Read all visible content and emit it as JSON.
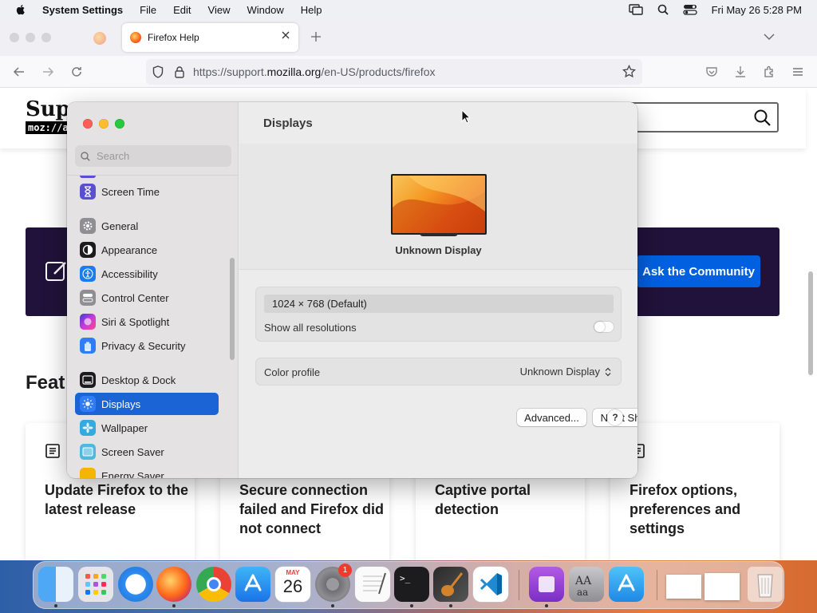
{
  "menubar": {
    "app_name": "System Settings",
    "items": [
      "File",
      "Edit",
      "View",
      "Window",
      "Help"
    ],
    "clock": "Fri May 26  5:28 PM"
  },
  "browser": {
    "tab_title": "Firefox Help",
    "url_prefix": "https://support.",
    "url_host": "mozilla.org",
    "url_path": "/en-US/products/firefox"
  },
  "page": {
    "logo_top": "Supp",
    "logo_badge": "moz://a",
    "banner_button": "Ask the Community",
    "featured_heading": "Feat",
    "cards": [
      "Update Firefox to the latest release",
      "Secure connection failed and Firefox did not connect",
      "Captive portal detection",
      "Firefox options, preferences and settings"
    ]
  },
  "settings": {
    "search_placeholder": "Search",
    "sidebar": [
      {
        "label": "Screen Time",
        "icon": "hourglass-icon",
        "color": "#5b4fd1"
      },
      {
        "label": "General",
        "icon": "gear-icon",
        "color": "#8e8e93"
      },
      {
        "label": "Appearance",
        "icon": "appearance-icon",
        "color": "#1c1c1e"
      },
      {
        "label": "Accessibility",
        "icon": "accessibility-icon",
        "color": "#1a7cf0"
      },
      {
        "label": "Control Center",
        "icon": "control-center-icon",
        "color": "#8e8e93"
      },
      {
        "label": "Siri & Spotlight",
        "icon": "siri-icon",
        "color": "#b43ad6"
      },
      {
        "label": "Privacy & Security",
        "icon": "hand-icon",
        "color": "#2f7cf6"
      },
      {
        "label": "Desktop & Dock",
        "icon": "dock-icon",
        "color": "#1c1c1e"
      },
      {
        "label": "Displays",
        "icon": "sun-icon",
        "color": "#2f7cf6"
      },
      {
        "label": "Wallpaper",
        "icon": "flower-icon",
        "color": "#35aadc"
      },
      {
        "label": "Screen Saver",
        "icon": "screen-saver-icon",
        "color": "#4fb8e0"
      },
      {
        "label": "Energy Saver",
        "icon": "battery-icon",
        "color": "#f4b400"
      }
    ],
    "title": "Displays",
    "display_name": "Unknown Display",
    "resolution": "1024 × 768 (Default)",
    "show_all_resolutions": "Show all resolutions",
    "show_all_enabled": false,
    "color_profile_label": "Color profile",
    "color_profile_value": "Unknown Display",
    "advanced_button": "Advanced...",
    "night_shift_button": "Night Shift...",
    "help_button": "?",
    "accent": "#1a64d6"
  },
  "dock": {
    "calendar_month": "MAY",
    "calendar_day": "26",
    "settings_badge": "1",
    "terminal_prompt": ">_",
    "items": [
      "finder-icon",
      "launchpad-icon",
      "safari-icon",
      "firefox-icon",
      "chrome-icon",
      "app-store-icon",
      "calendar-icon",
      "system-settings-icon",
      "textedit-icon",
      "terminal-icon",
      "garageband-icon",
      "vscode-icon",
      "podcasts-icon",
      "font-book-icon",
      "app-store-icon-2",
      "window-preview-icon",
      "trash-icon"
    ]
  }
}
